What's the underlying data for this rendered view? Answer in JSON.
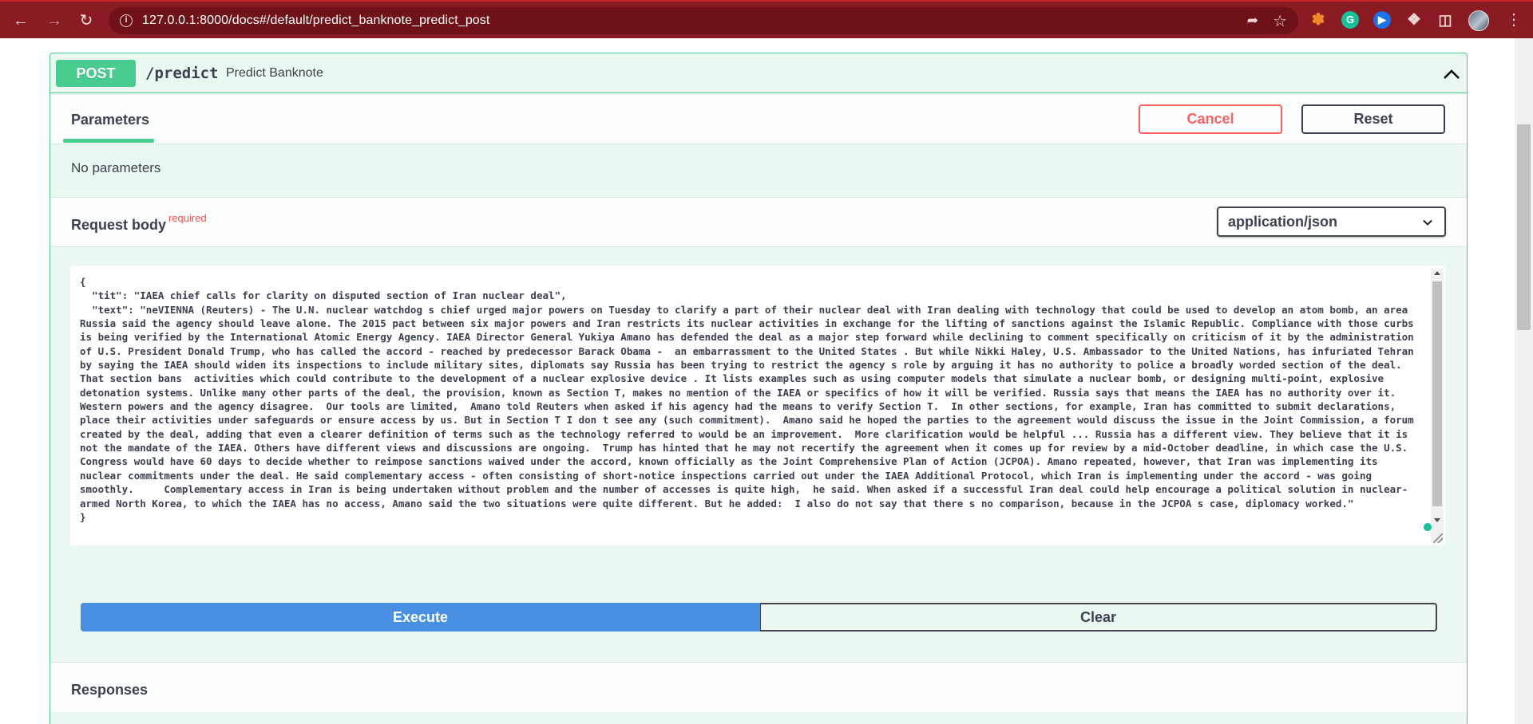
{
  "browser": {
    "url": "127.0.0.1:8000/docs#/default/predict_banknote_predict_post"
  },
  "operation": {
    "method": "POST",
    "path": "/predict",
    "summary": "Predict Banknote"
  },
  "parameters": {
    "tab_label": "Parameters",
    "cancel_label": "Cancel",
    "reset_label": "Reset",
    "empty_text": "No parameters"
  },
  "request_body": {
    "title": "Request body",
    "required_label": "required",
    "content_type": "application/json",
    "value": "{\n  \"tit\": \"IAEA chief calls for clarity on disputed section of Iran nuclear deal\",\n  \"text\": \"neVIENNA (Reuters) - The U.N. nuclear watchdog s chief urged major powers on Tuesday to clarify a part of their nuclear deal with Iran dealing with technology that could be used to develop an atom bomb, an area Russia said the agency should leave alone. The 2015 pact between six major powers and Iran restricts its nuclear activities in exchange for the lifting of sanctions against the Islamic Republic. Compliance with those curbs is being verified by the International Atomic Energy Agency. IAEA Director General Yukiya Amano has defended the deal as a major step forward while declining to comment specifically on criticism of it by the administration of U.S. President Donald Trump, who has called the accord - reached by predecessor Barack Obama -  an embarrassment to the United States . But while Nikki Haley, U.S. Ambassador to the United Nations, has infuriated Tehran by saying the IAEA should widen its inspections to include military sites, diplomats say Russia has been trying to restrict the agency s role by arguing it has no authority to police a broadly worded section of the deal. That section bans  activities which could contribute to the development of a nuclear explosive device . It lists examples such as using computer models that simulate a nuclear bomb, or designing multi-point, explosive detonation systems. Unlike many other parts of the deal, the provision, known as Section T, makes no mention of the IAEA or specifics of how it will be verified. Russia says that means the IAEA has no authority over it. Western powers and the agency disagree.  Our tools are limited,  Amano told Reuters when asked if his agency had the means to verify Section T.  In other sections, for example, Iran has committed to submit declarations, place their activities under safeguards or ensure access by us. But in Section T I don t see any (such commitment).  Amano said he hoped the parties to the agreement would discuss the issue in the Joint Commission, a forum created by the deal, adding that even a clearer definition of terms such as the technology referred to would be an improvement.  More clarification would be helpful ... Russia has a different view. They believe that it is not the mandate of the IAEA. Others have different views and discussions are ongoing.  Trump has hinted that he may not recertify the agreement when it comes up for review by a mid-October deadline, in which case the U.S. Congress would have 60 days to decide whether to reimpose sanctions waived under the accord, known officially as the Joint Comprehensive Plan of Action (JCPOA). Amano repeated, however, that Iran was implementing its nuclear commitments under the deal. He said complementary access - often consisting of short-notice inspections carried out under the IAEA Additional Protocol, which Iran is implementing under the accord - was going smoothly.     Complementary access in Iran is being undertaken without problem and the number of accesses is quite high,  he said. When asked if a successful Iran deal could help encourage a political solution in nuclear-armed North Korea, to which the IAEA has no access, Amano said the two situations were quite different. But he added:  I also do not say that there s no comparison, because in the JCPOA s case, diplomacy worked.\"\n}"
  },
  "actions": {
    "execute_label": "Execute",
    "clear_label": "Clear"
  },
  "responses": {
    "title": "Responses"
  },
  "colors": {
    "browser_frame": "#8b1b22",
    "post_green": "#49cc90",
    "execute_blue": "#4990e2",
    "cancel_red": "#ff6060",
    "panel_bg": "#ebf8f1"
  }
}
